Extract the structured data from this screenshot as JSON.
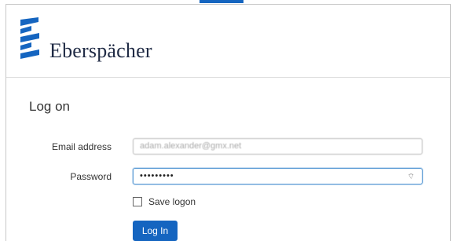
{
  "brand": {
    "name": "Eberspächer",
    "logo_icon": "eberspaecher-e-icon",
    "logo_color": "#1565c0"
  },
  "form": {
    "title": "Log on",
    "email_label": "Email address",
    "email_value": "adam.alexander@gmx.net",
    "password_label": "Password",
    "password_value": "•••••••••",
    "password_reveal_icon": "reveal-password-icon",
    "save_logon_label": "Save logon",
    "save_logon_checked": false,
    "submit_label": "Log In"
  },
  "colors": {
    "accent": "#1565c0",
    "focus_border": "#5b9bd5"
  }
}
